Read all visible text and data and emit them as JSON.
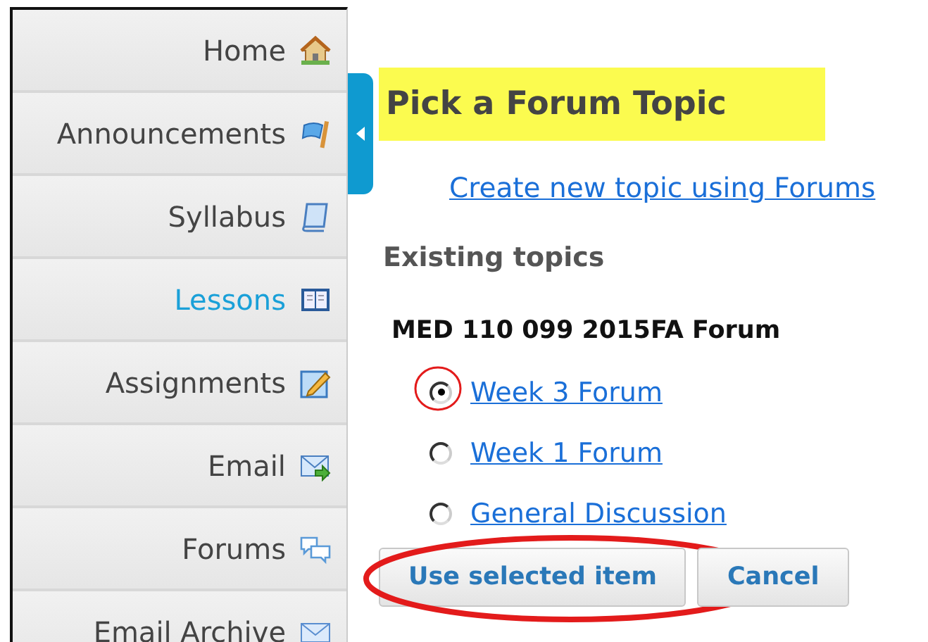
{
  "sidebar": {
    "items": [
      {
        "label": "Home",
        "selected": false
      },
      {
        "label": "Announcements",
        "selected": false
      },
      {
        "label": "Syllabus",
        "selected": false
      },
      {
        "label": "Lessons",
        "selected": true
      },
      {
        "label": "Assignments",
        "selected": false
      },
      {
        "label": "Email",
        "selected": false
      },
      {
        "label": "Forums",
        "selected": false
      },
      {
        "label": "Email Archive",
        "selected": false
      }
    ]
  },
  "title": "Pick a Forum Topic",
  "create_link": "Create new topic using Forums",
  "section_heading": "Existing topics",
  "forum_name": "MED 110 099 2015FA Forum",
  "topics": [
    {
      "label": "Week 3 Forum",
      "selected": true,
      "circled": true
    },
    {
      "label": "Week 1 Forum",
      "selected": false,
      "circled": false
    },
    {
      "label": "General Discussion",
      "selected": false,
      "circled": false
    }
  ],
  "buttons": [
    {
      "label": "Use selected item",
      "circled": true
    },
    {
      "label": "Cancel",
      "circled": false
    }
  ]
}
